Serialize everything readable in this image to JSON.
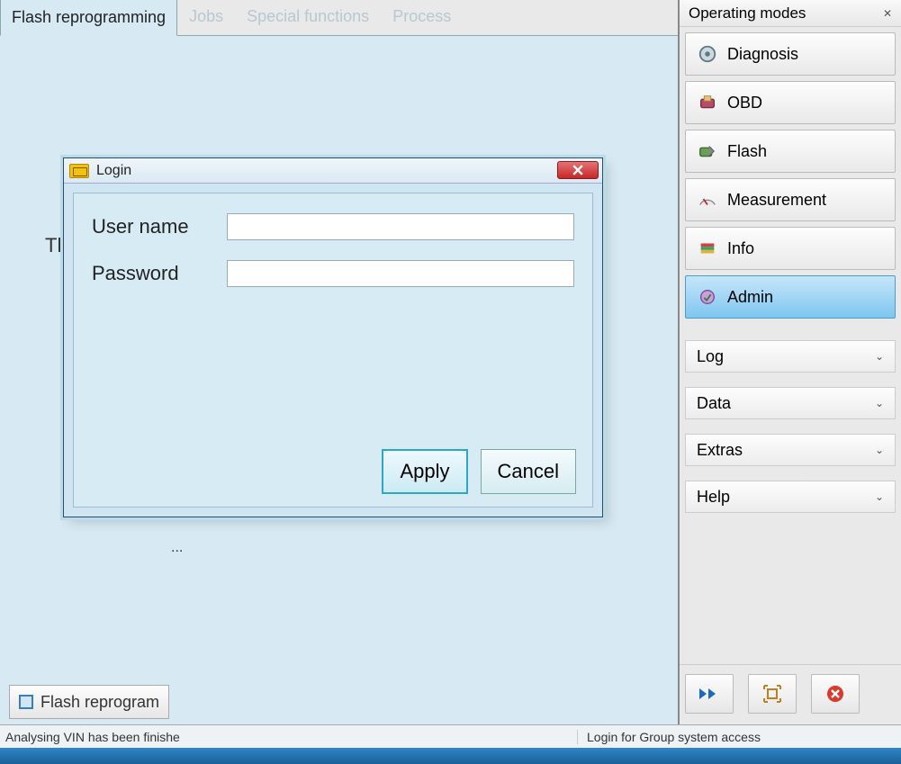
{
  "tabs": {
    "flash_reprogramming": "Flash reprogramming",
    "jobs": "Jobs",
    "special_functions": "Special functions",
    "process": "Process"
  },
  "main": {
    "bg_text_fragment": "Th",
    "ellipsis": "..."
  },
  "dialog": {
    "title": "Login",
    "username_label": "User name",
    "password_label": "Password",
    "username_value": "",
    "password_value": "",
    "apply_label": "Apply",
    "cancel_label": "Cancel"
  },
  "bottom_tab": {
    "label": "Flash reprogram"
  },
  "sidebar": {
    "header": "Operating modes",
    "modes": {
      "diagnosis": "Diagnosis",
      "obd": "OBD",
      "flash": "Flash",
      "measurement": "Measurement",
      "info": "Info",
      "admin": "Admin"
    },
    "panels": {
      "log": "Log",
      "data": "Data",
      "extras": "Extras",
      "help": "Help"
    }
  },
  "status": {
    "left": "Analysing VIN has been finishe",
    "right": "Login for Group system access"
  }
}
